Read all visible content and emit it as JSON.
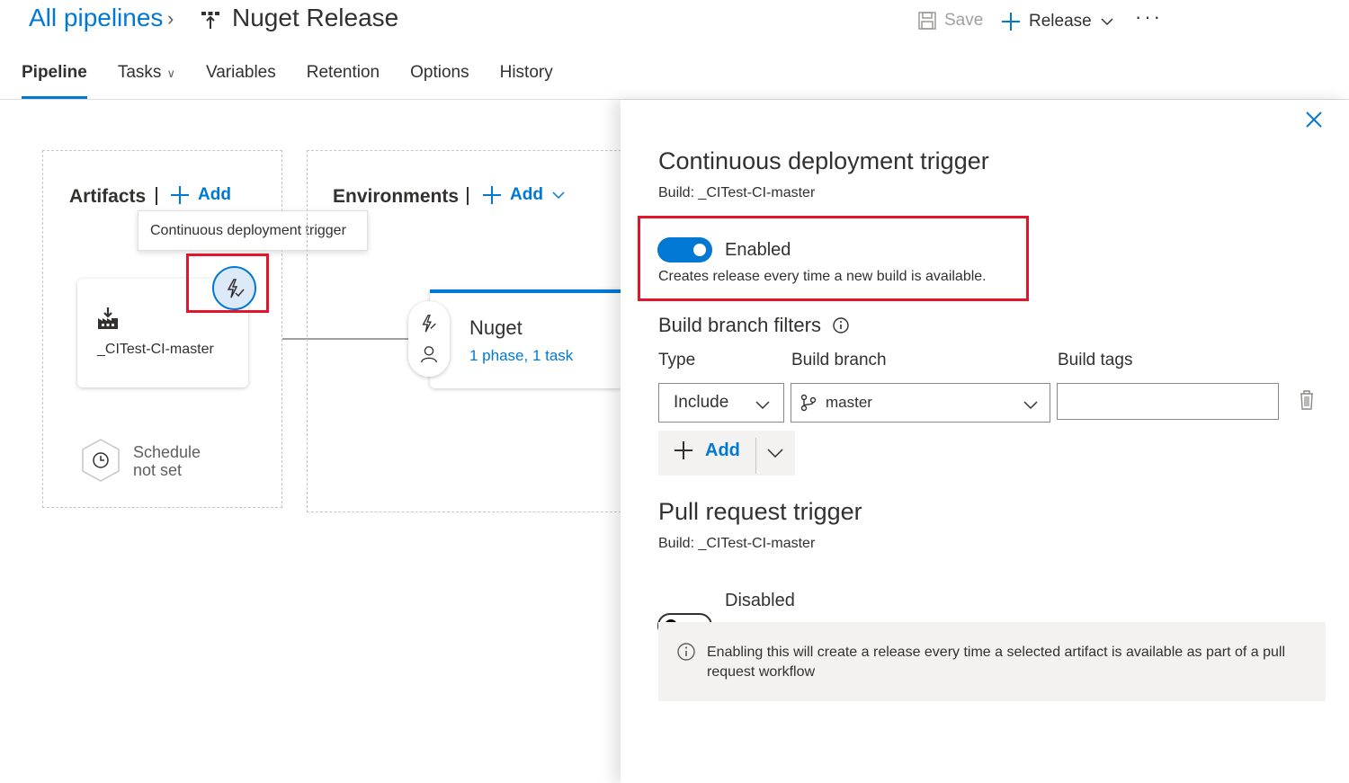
{
  "header": {
    "breadcrumb": "All pipelines",
    "pipeline_title": "Nuget Release",
    "save_label": "Save",
    "release_label": "Release",
    "more_label": "···"
  },
  "tabs": [
    {
      "label": "Pipeline"
    },
    {
      "label": "Tasks"
    },
    {
      "label": "Variables"
    },
    {
      "label": "Retention"
    },
    {
      "label": "Options"
    },
    {
      "label": "History"
    }
  ],
  "artifacts": {
    "title": "Artifacts",
    "add_label": "Add",
    "tooltip": "Continuous deployment trigger",
    "artifact_name": "_CITest-CI-master",
    "schedule_line1": "Schedule",
    "schedule_line2": "not set"
  },
  "environments": {
    "title": "Environments",
    "add_label": "Add",
    "env_name": "Nuget",
    "env_sub": "1 phase, 1 task"
  },
  "panel": {
    "cd_title": "Continuous deployment trigger",
    "cd_build": "Build: _CITest-CI-master",
    "cd_toggle_label": "Enabled",
    "cd_toggle_desc": "Creates release every time a new build is available.",
    "filters_title": "Build branch filters",
    "col_type": "Type",
    "col_branch": "Build branch",
    "col_tags": "Build tags",
    "type_value": "Include",
    "branch_value": "master",
    "tags_value": "",
    "add_label": "Add",
    "pr_title": "Pull request trigger",
    "pr_build": "Build: _CITest-CI-master",
    "pr_toggle_label": "Disabled",
    "pr_info": "Enabling this will create a release every time a selected artifact is available as part of a pull request workflow"
  },
  "colors": {
    "accent": "#0078d4",
    "highlight_red": "#e3142c"
  }
}
